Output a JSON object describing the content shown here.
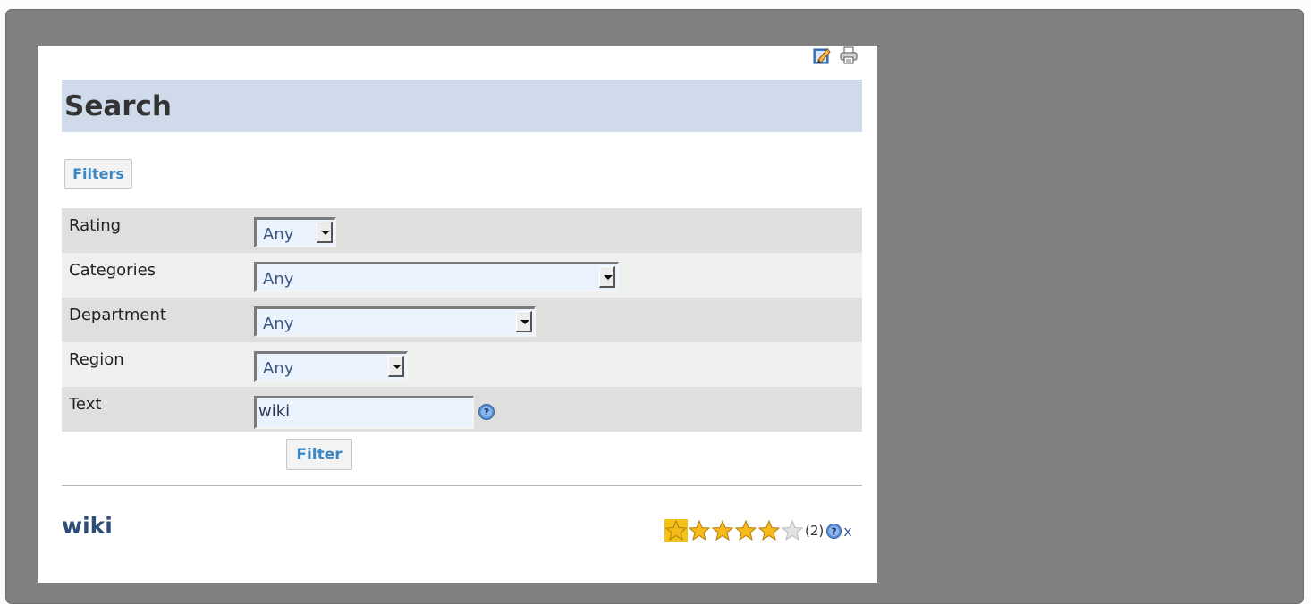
{
  "page": {
    "title": "Search",
    "filters_label": "Filters",
    "filter_button_label": "Filter"
  },
  "form": {
    "rating": {
      "label": "Rating",
      "value": "Any"
    },
    "categories": {
      "label": "Categories",
      "value": "Any"
    },
    "department": {
      "label": "Department",
      "value": "Any"
    },
    "region": {
      "label": "Region",
      "value": "Any"
    },
    "text": {
      "label": "Text",
      "value": "wiki"
    }
  },
  "result": {
    "title": "wiki",
    "rating_stars": 5,
    "rating_max": 6,
    "vote_count": "(2)",
    "remove_label": "x"
  },
  "icons": {
    "edit": "edit-icon",
    "print": "print-icon",
    "help": "help-icon",
    "star": "star-icon"
  },
  "colors": {
    "header_bg": "#cfdaeb",
    "link_blue": "#3a87c4",
    "title_blue": "#2e4c78",
    "star_gold": "#f5b91a",
    "frame_gray": "#808080"
  }
}
